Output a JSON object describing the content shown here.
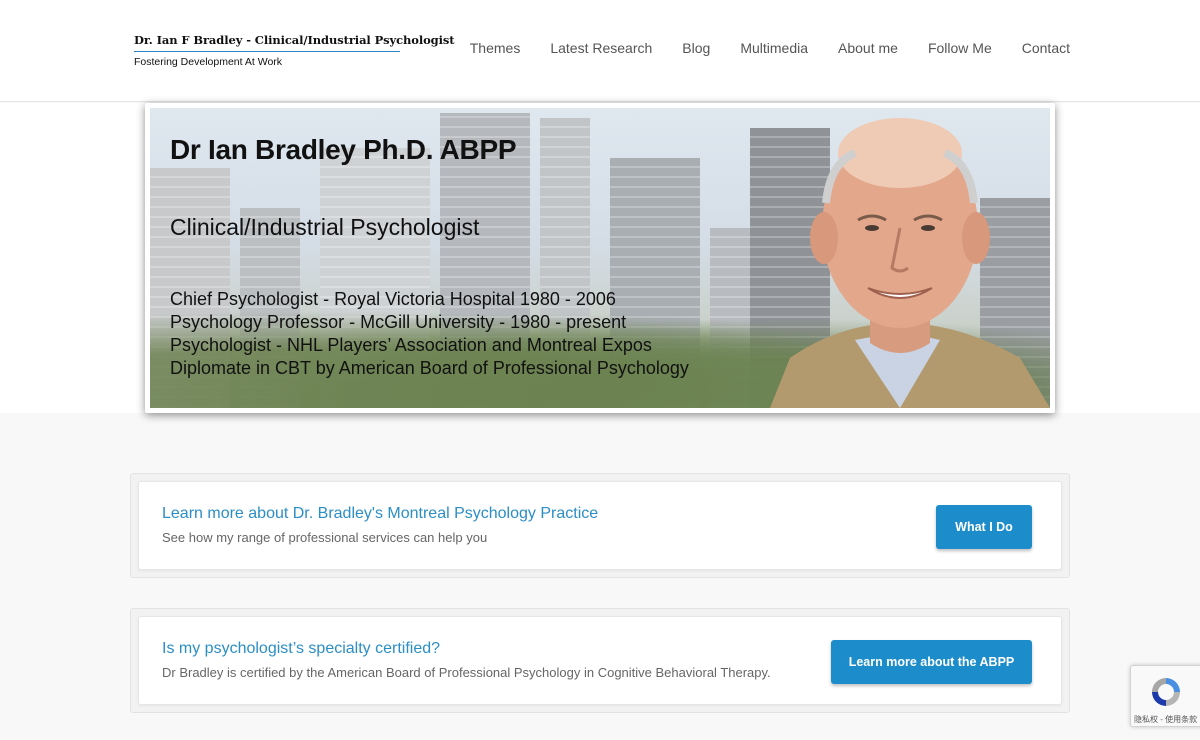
{
  "logo": {
    "title": "Dr. Ian F Bradley - Clinical/Industrial Psychologist",
    "tagline": "Fostering Development At Work"
  },
  "nav": {
    "items": [
      "Themes",
      "Latest Research",
      "Blog",
      "Multimedia",
      "About me",
      "Follow Me",
      "Contact"
    ]
  },
  "hero": {
    "name": "Dr Ian Bradley Ph.D. ABPP",
    "role": "Clinical/Industrial Psychologist",
    "credentials": [
      "Chief Psychologist - Royal Victoria Hospital 1980 - 2006",
      "Psychology Professor - McGill University - 1980 - present",
      "Psychologist - NHL Players’ Association and Montreal Expos",
      "Diplomate in CBT by American Board of Professional Psychology"
    ]
  },
  "cards": [
    {
      "title": "Learn more about Dr. Bradley's Montreal Psychology Practice",
      "subtitle": "See how my range of professional services can help you",
      "button": "What I Do"
    },
    {
      "title": "Is my psychologist’s specialty certified?",
      "subtitle": "Dr Bradley is certified by the American Board of Professional Psychology in Cognitive Behavioral Therapy.",
      "button": "Learn more about the ABPP"
    }
  ],
  "recaptcha": {
    "text": "隐私权 - 使用条款"
  },
  "colors": {
    "accent": "#1d8ccb",
    "link": "#2b8ec6"
  }
}
